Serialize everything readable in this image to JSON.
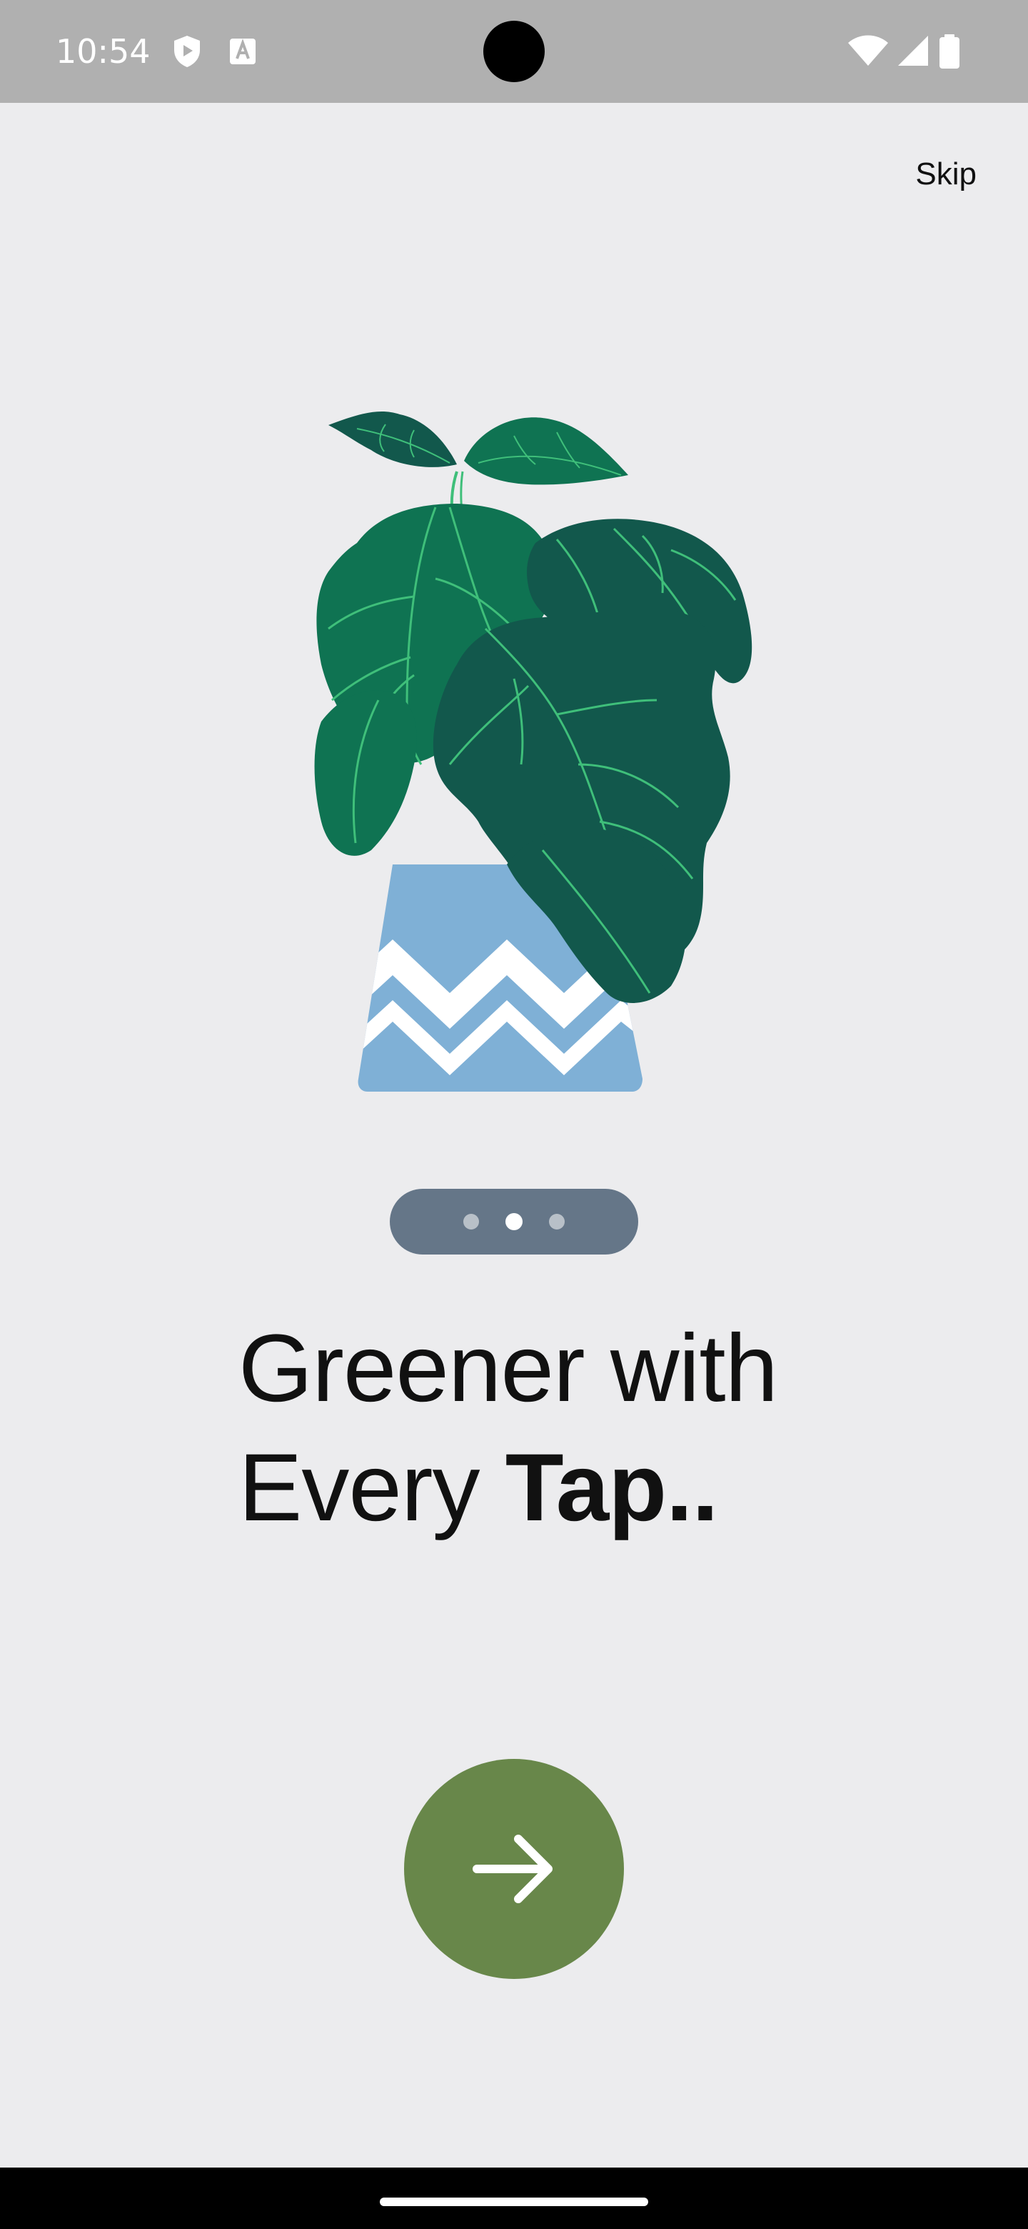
{
  "status_bar": {
    "time": "10:54",
    "icons": [
      "play-shield-icon",
      "a-box-icon",
      "wifi-icon",
      "cellular-signal-icon",
      "battery-icon"
    ]
  },
  "onboarding": {
    "skip_label": "Skip",
    "pager": {
      "count": 3,
      "active_index": 1
    },
    "headline_line1": "Greener with",
    "headline_line2_light": "Every ",
    "headline_line2_bold": "Tap..",
    "next_icon": "arrow-right-icon"
  },
  "colors": {
    "background": "#ececee",
    "status_bar": "#b0b0b0",
    "pager_pill": "#657688",
    "next_button": "#68874a",
    "leaf_light": "#0f7352",
    "leaf_dark": "#12584c",
    "pot": "#7fb0d6"
  }
}
